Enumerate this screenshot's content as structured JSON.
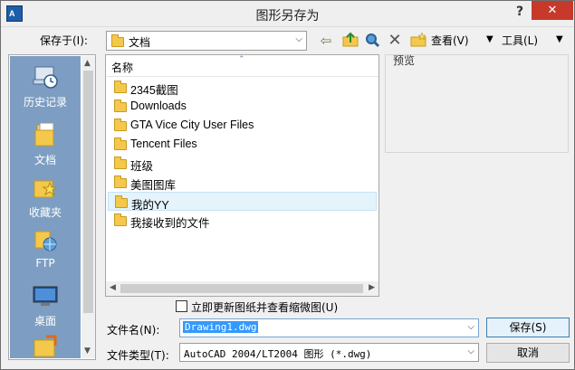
{
  "window": {
    "title": "图形另存为",
    "app_icon": "A",
    "help": "?",
    "close": "✕"
  },
  "save_in": {
    "label": "保存于(I):",
    "value": "文档"
  },
  "toolbar": {
    "view_label": "查看(V)",
    "tools_label": "工具(L)"
  },
  "places": [
    {
      "label": "历史记录",
      "icon": "history-icon"
    },
    {
      "label": "文档",
      "icon": "documents-icon"
    },
    {
      "label": "收藏夹",
      "icon": "favorites-icon"
    },
    {
      "label": "FTP",
      "icon": "ftp-icon"
    },
    {
      "label": "桌面",
      "icon": "desktop-icon"
    }
  ],
  "filelist": {
    "column_name": "名称",
    "items": [
      "2345截图",
      "Downloads",
      "GTA Vice City User Files",
      "Tencent Files",
      "班级",
      "美图图库",
      "我的YY",
      "我接收到的文件"
    ],
    "selected_index": 6
  },
  "preview": {
    "label": "预览"
  },
  "options": {
    "update_thumbnail_label": "立即更新图纸并查看缩微图(U)"
  },
  "filename": {
    "label": "文件名(N):",
    "value": "Drawing1.dwg"
  },
  "filetype": {
    "label": "文件类型(T):",
    "value": "AutoCAD 2004/LT2004 图形 (*.dwg)"
  },
  "buttons": {
    "save": "保存(S)",
    "cancel": "取消"
  },
  "colors": {
    "places_bg": "#7d9ec2",
    "close_bg": "#c7392a",
    "selection": "#3399ff"
  }
}
